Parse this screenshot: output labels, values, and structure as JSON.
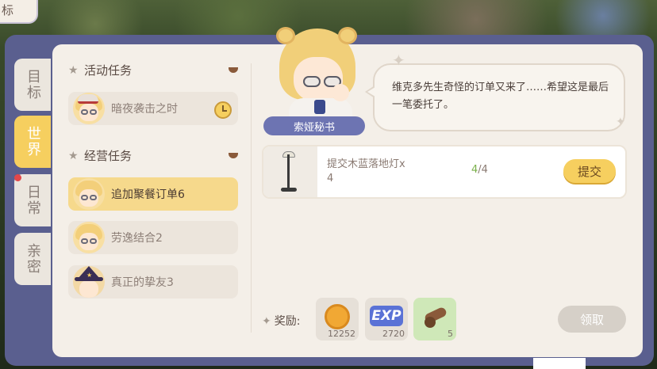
{
  "corner": {
    "label": "标"
  },
  "tabs": [
    {
      "label": "目标",
      "active": false,
      "badge": false
    },
    {
      "label": "世界",
      "active": true,
      "badge": false
    },
    {
      "label": "日常",
      "active": false,
      "badge": true
    },
    {
      "label": "亲密",
      "active": false,
      "badge": false
    }
  ],
  "sections": {
    "activity": {
      "title": "活动任务"
    },
    "business": {
      "title": "经营任务"
    }
  },
  "tasks": [
    {
      "label": "暗夜袭击之时"
    },
    {
      "label": "追加聚餐订单6"
    },
    {
      "label": "劳逸结合2"
    },
    {
      "label": "真正的挚友3"
    }
  ],
  "npc": {
    "name": "索娅秘书"
  },
  "dialog": {
    "text": "维克多先生奇怪的订单又来了……希望这是最后一笔委托了。"
  },
  "request": {
    "item_name": "提交木蓝落地灯x",
    "item_qty": "4",
    "progress_current": "4",
    "progress_sep_total": "/4",
    "submit_label": "提交"
  },
  "rewards": {
    "label": "奖励:",
    "items": [
      {
        "icon": "coin-icon",
        "count": "12252"
      },
      {
        "icon": "exp-icon",
        "text": "EXP",
        "count": "2720"
      },
      {
        "icon": "cannon-icon",
        "count": "5"
      }
    ]
  },
  "claim_label": "领取",
  "colors": {
    "accent": "#f6cf5f",
    "frame": "#5a5f8f",
    "panel": "#f4efe8"
  }
}
